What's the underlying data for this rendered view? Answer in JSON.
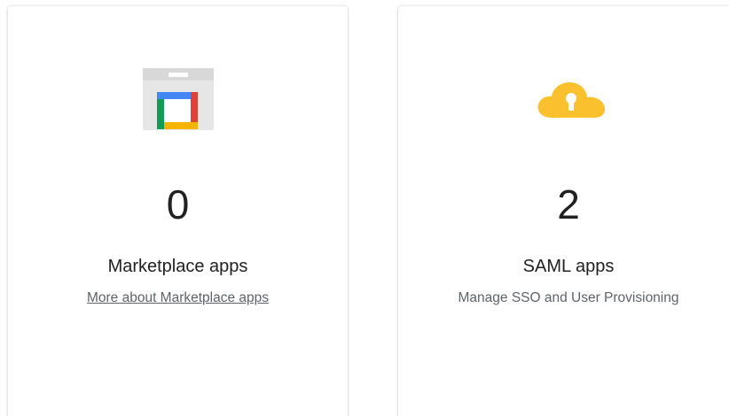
{
  "cards": [
    {
      "icon": "marketplace-bag-icon",
      "count": "0",
      "title": "Marketplace apps",
      "link_text": "More about Marketplace apps"
    },
    {
      "icon": "cloud-lock-icon",
      "count": "2",
      "title": "SAML apps",
      "subtext": "Manage SSO and User Provisioning"
    }
  ],
  "colors": {
    "google_blue": "#4285F4",
    "google_red": "#DB4437",
    "google_yellow": "#F4B400",
    "google_green": "#0F9D58",
    "cloud_yellow": "#FBC02D"
  }
}
